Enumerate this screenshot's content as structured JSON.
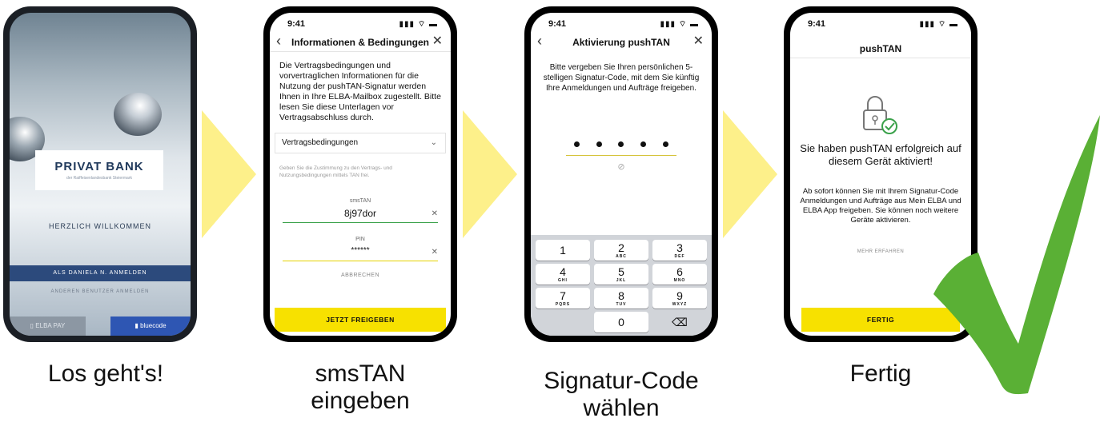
{
  "steps": [
    {
      "caption": "Los geht's!"
    },
    {
      "caption_l1": "smsTAN",
      "caption_l2": "eingeben"
    },
    {
      "caption_l1": "Signatur-Code",
      "caption_l2": "wählen"
    },
    {
      "caption": "Fertig"
    }
  ],
  "phone1": {
    "bank_name": "PRIVAT BANK",
    "bank_sub": "der Raiffeisenlandesbank Steiermark",
    "welcome": "HERZLICH WILLKOMMEN",
    "login_button": "ALS DANIELA N. ANMELDEN",
    "other_user": "ANDEREN BENUTZER ANMELDEN",
    "elba_pay": "ELBA PAY",
    "bluecode": "bluecode"
  },
  "phone2": {
    "time": "9:41",
    "status_icons": "▮▮▮ ⌔ ▬",
    "title": "Informationen & Bedingungen",
    "back": "‹",
    "close": "✕",
    "intro": "Die Vertragsbedingungen und vorvertraglichen Informationen für die Nutzung der pushTAN-Signatur werden Ihnen in Ihre ELBA-Mailbox zugestellt. Bitte lesen Sie diese Unterlagen vor Vertragsabschluss durch.",
    "select_label": "Vertragsbedingungen",
    "consent": "Geben Sie die Zustimmung zu den Vertrags- und Nutzungsbedingungen mittels TAN frei.",
    "smstan_label": "smsTAN",
    "smstan_value": "8j97dor",
    "pin_label": "PIN",
    "pin_value": "******",
    "clear": "✕",
    "cancel": "ABBRECHEN",
    "cta": "JETZT FREIGEBEN",
    "colors": {
      "smstan_line": "#3aa14a",
      "pin_line": "#e6d200",
      "cta": "#f7e100"
    }
  },
  "phone3": {
    "time": "9:41",
    "status_icons": "▮▮▮ ⌔ ▬",
    "title": "Aktivierung pushTAN",
    "back": "‹",
    "close": "✕",
    "intro": "Bitte vergeben Sie Ihren persönlichen 5-stelligen Signatur-Code, mit dem Sie künftig Ihre Anmeldungen und Aufträge freigeben.",
    "pin_dots": 5,
    "eye": "⊘",
    "keys": [
      {
        "n": "1",
        "l": ""
      },
      {
        "n": "2",
        "l": "ABC"
      },
      {
        "n": "3",
        "l": "DEF"
      },
      {
        "n": "4",
        "l": "GHI"
      },
      {
        "n": "5",
        "l": "JKL"
      },
      {
        "n": "6",
        "l": "MNO"
      },
      {
        "n": "7",
        "l": "PQRS"
      },
      {
        "n": "8",
        "l": "TUV"
      },
      {
        "n": "9",
        "l": "WXYZ"
      },
      {
        "n": "0",
        "l": ""
      }
    ],
    "delete": "⌫"
  },
  "phone4": {
    "time": "9:41",
    "status_icons": "▮▮▮ ⌔ ▬",
    "title": "pushTAN",
    "headline": "Sie haben pushTAN erfolgreich auf diesem Gerät aktiviert!",
    "body": "Ab sofort können Sie mit Ihrem Signatur-Code Anmeldungen und Aufträge aus Mein ELBA und ELBA App freigeben. Sie können noch weitere Geräte aktivieren.",
    "more": "MEHR ERFAHREN",
    "cta": "FERTIG",
    "colors": {
      "lock": "#777777",
      "badge": "#3aa14a"
    }
  },
  "colors": {
    "arrow": "#fdf08a",
    "check": "#5ab035"
  }
}
